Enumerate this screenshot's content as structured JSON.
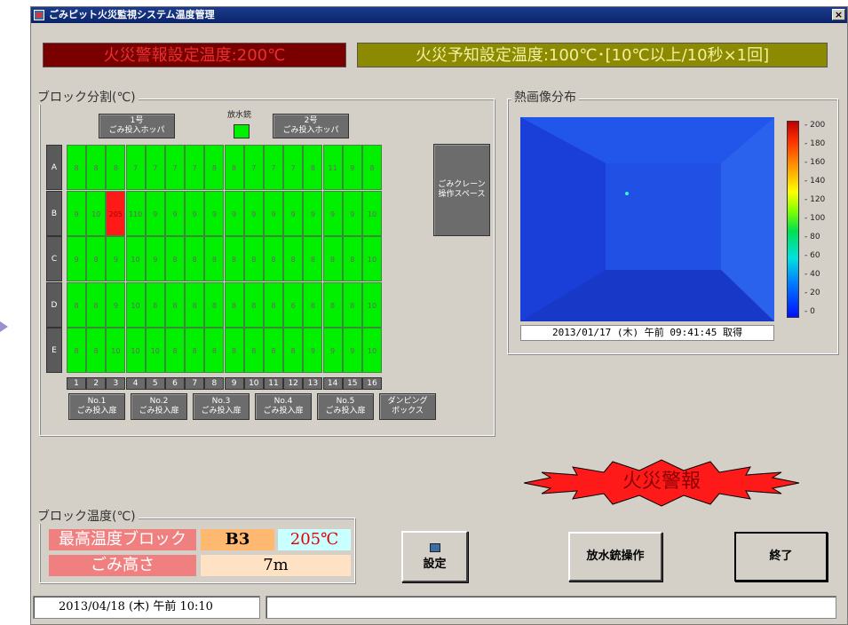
{
  "window": {
    "title": "ごみピット火災監視システム温度管理",
    "close": "×"
  },
  "banners": {
    "alarm_setting": "火災警報設定温度:200℃",
    "prediction_setting": "火災予知設定温度:100℃･[10℃以上/10秒×1回]"
  },
  "block_panel": {
    "title": "ブロック分割(℃)",
    "hopper1": "1号\nごみ投入ホッパ",
    "nozzle_label": "放水銃",
    "hopper2": "2号\nごみ投入ホッパ",
    "crane_space": "ごみクレーン\n操作スペース",
    "rows": [
      "A",
      "B",
      "C",
      "D",
      "E"
    ],
    "columns": [
      "1",
      "2",
      "3",
      "4",
      "5",
      "6",
      "7",
      "8",
      "9",
      "10",
      "11",
      "12",
      "13",
      "14",
      "15",
      "16"
    ],
    "grid": [
      [
        "8",
        "8",
        "8",
        "7",
        "7",
        "7",
        "7",
        "8",
        "8",
        "7",
        "7",
        "7",
        "8",
        "11",
        "9",
        "8"
      ],
      [
        "9",
        "10",
        "205",
        "110",
        "9",
        "9",
        "9",
        "9",
        "9",
        "9",
        "9",
        "9",
        "9",
        "9",
        "9",
        "10"
      ],
      [
        "9",
        "8",
        "9",
        "10",
        "9",
        "8",
        "8",
        "8",
        "8",
        "8",
        "8",
        "8",
        "8",
        "8",
        "8",
        "10"
      ],
      [
        "8",
        "8",
        "9",
        "10",
        "8",
        "8",
        "8",
        "8",
        "8",
        "8",
        "8",
        "6",
        "8",
        "8",
        "8",
        "10"
      ],
      [
        "8",
        "8",
        "10",
        "10",
        "10",
        "8",
        "8",
        "8",
        "8",
        "8",
        "8",
        "8",
        "9",
        "9",
        "9",
        "10"
      ]
    ],
    "doors": [
      "No.1\nごみ投入扉",
      "No.2\nごみ投入扉",
      "No.3\nごみ投入扉",
      "No.4\nごみ投入扉",
      "No.5\nごみ投入扉",
      "ダンピング\nボックス"
    ]
  },
  "thermal": {
    "title": "熱画像分布",
    "timestamp": "2013/01/17 (木) 午前 09:41:45 取得",
    "scale_ticks": [
      "200",
      "180",
      "160",
      "140",
      "120",
      "100",
      "80",
      "60",
      "40",
      "20",
      "0"
    ]
  },
  "fire_alarm": {
    "label": "火災警報",
    "color": "#ff1a1a"
  },
  "block_temp": {
    "title": "ブロック温度(℃)",
    "max_label": "最高温度ブロック",
    "max_block": "B3",
    "max_temp": "205℃",
    "height_label": "ごみ高さ",
    "height_value": "7m"
  },
  "buttons": {
    "settings": "設定",
    "nozzle_op": "放水銃操作",
    "exit": "終了"
  },
  "status": {
    "datetime": "2013/04/18 (木) 午前 10:10",
    "message": ""
  }
}
